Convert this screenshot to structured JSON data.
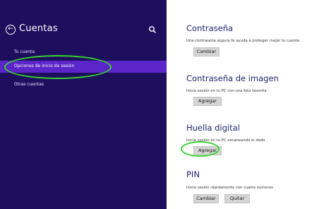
{
  "sidebar": {
    "title": "Cuentas",
    "items": [
      {
        "label": "Tu cuenta"
      },
      {
        "label": "Opciones de inicio de sesión"
      },
      {
        "label": "Otras cuentas"
      }
    ]
  },
  "sections": [
    {
      "title": "Contraseña",
      "description": "Una contraseña segura te ayuda a proteger mejor tu cuenta",
      "buttons": [
        "Cambiar"
      ]
    },
    {
      "title": "Contraseña de imagen",
      "description": "Inicia sesión en tu PC con una foto favorita",
      "buttons": [
        "Agregar"
      ]
    },
    {
      "title": "Huella digital",
      "description": "Inicia sesión en tu PC escaneando el dedo",
      "buttons": [
        "Agregar"
      ]
    },
    {
      "title": "PIN",
      "description": "Inicia sesión rápidamente con cuatro números",
      "buttons": [
        "Cambiar",
        "Quitar"
      ]
    }
  ],
  "colors": {
    "sidebar_bg": "#1e0f5e",
    "selected_bg": "#5b25c9",
    "heading": "#1f1f6e",
    "highlight": "#36d62e"
  },
  "icons": [
    "back-arrow-icon",
    "search-icon"
  ]
}
